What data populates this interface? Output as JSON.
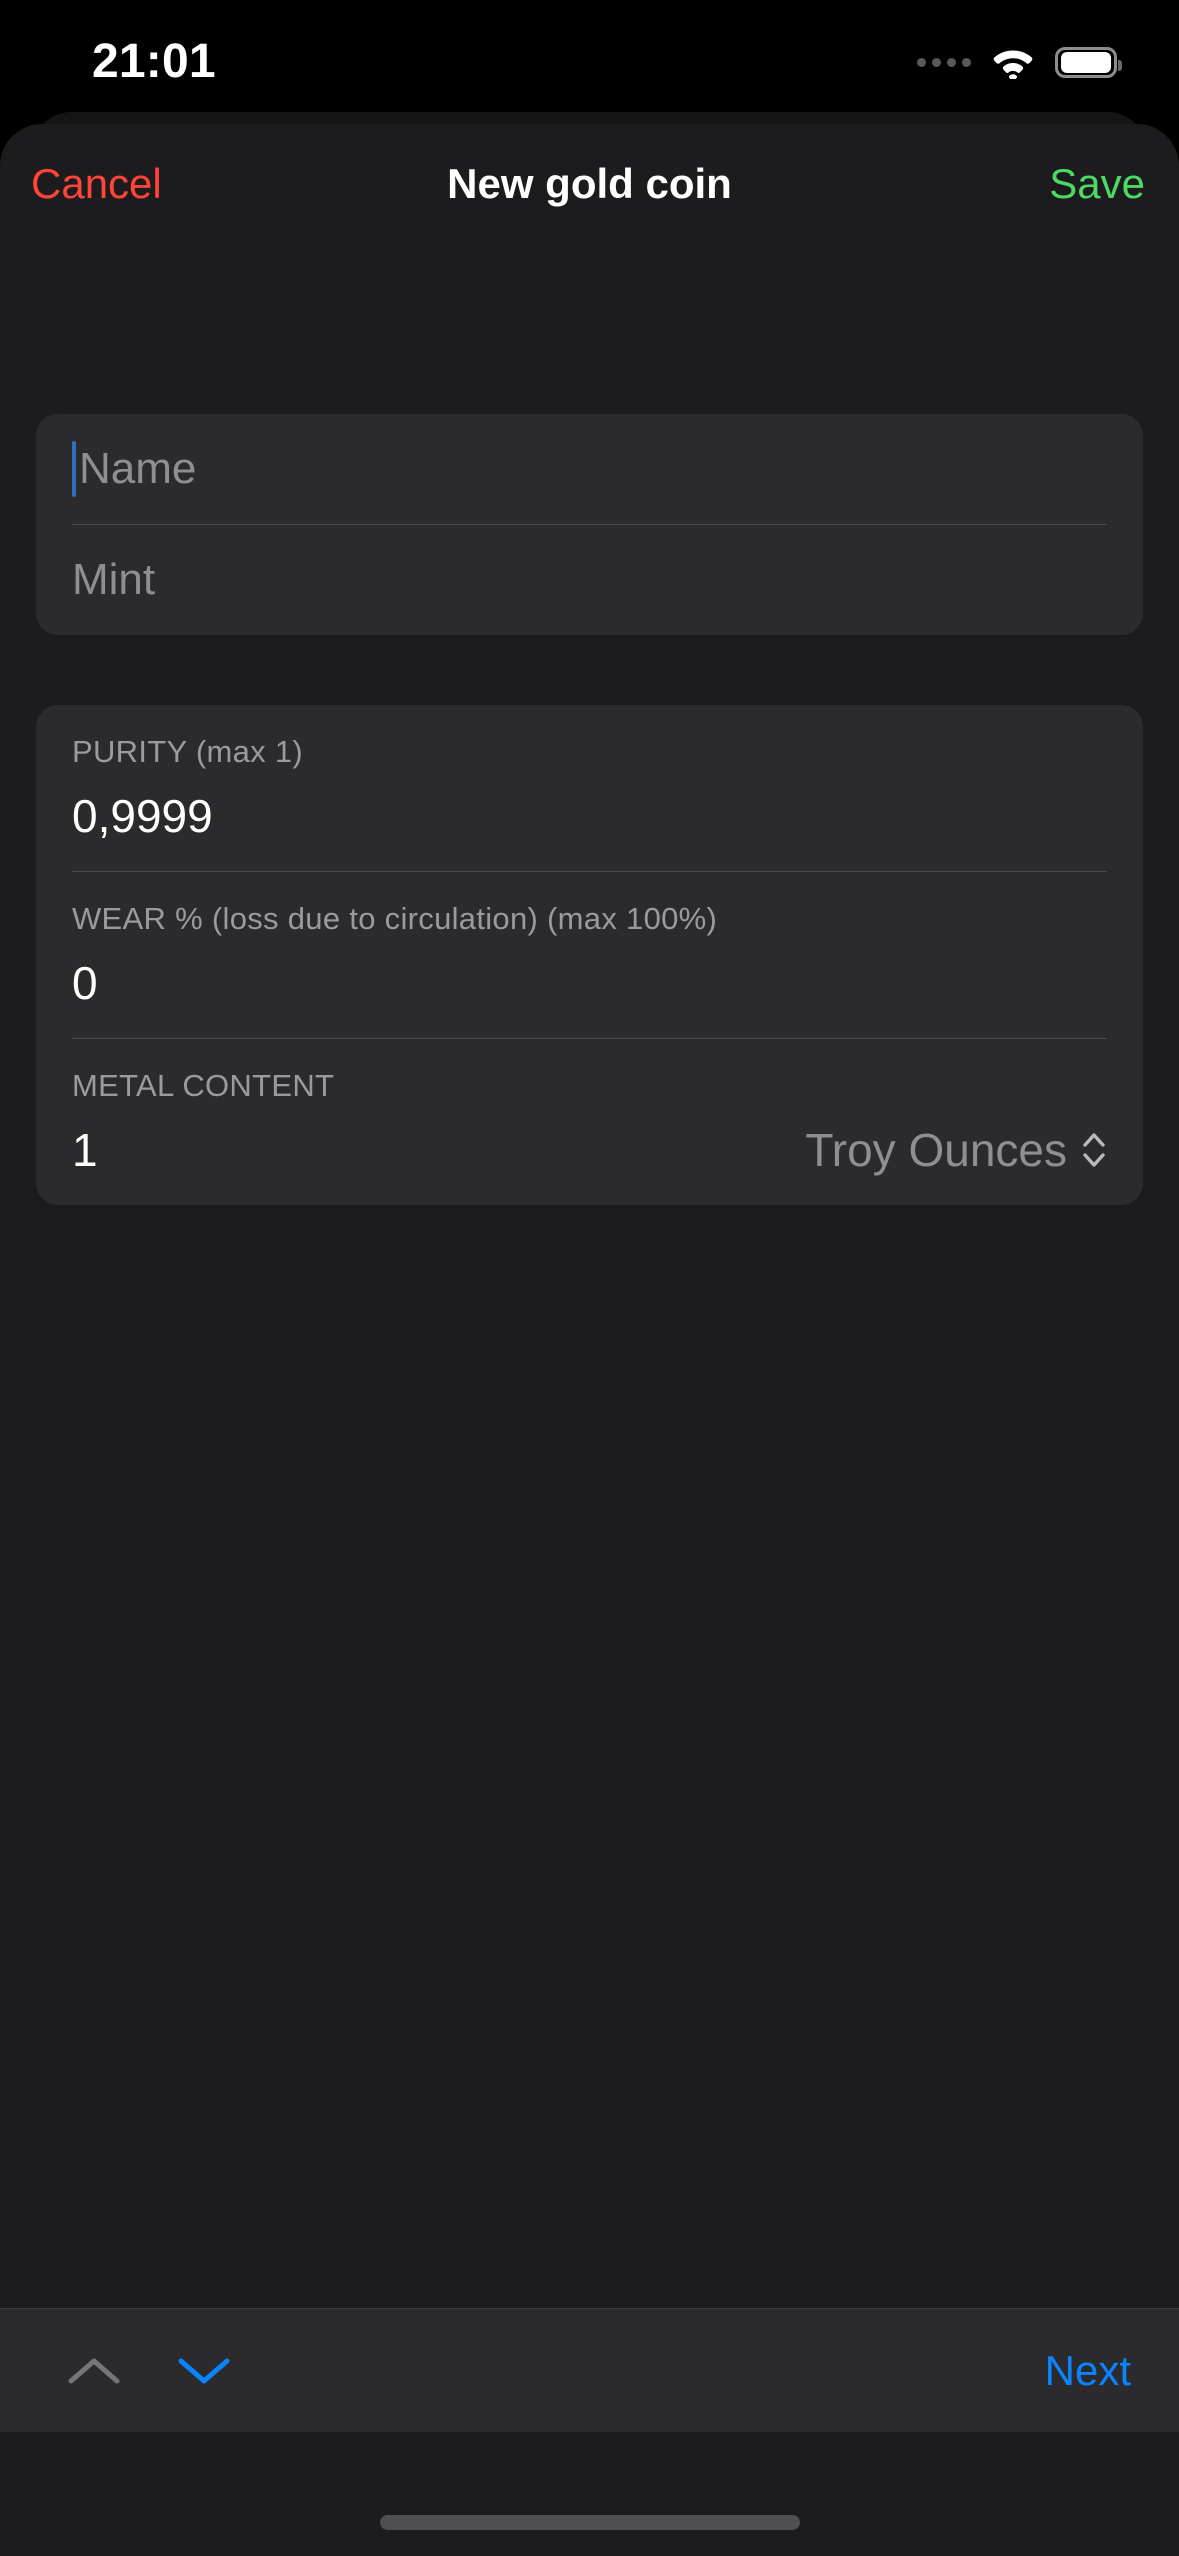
{
  "status_bar": {
    "time": "21:01",
    "cellular_icon": "cellular-dots-icon",
    "wifi_icon": "wifi-icon",
    "battery_icon": "battery-full-icon"
  },
  "navbar": {
    "cancel_label": "Cancel",
    "title": "New gold coin",
    "save_label": "Save",
    "cancel_color": "#ff453a",
    "save_color": "#4cd964"
  },
  "identity_card": {
    "name_field": {
      "value": "",
      "placeholder": "Name"
    },
    "mint_field": {
      "value": "",
      "placeholder": "Mint"
    }
  },
  "metrics_card": {
    "purity": {
      "label": "PURITY (max 1)",
      "value": "0,9999"
    },
    "wear": {
      "label": "WEAR % (loss due to circulation) (max 100%)",
      "value": "0"
    },
    "metal_content": {
      "label": "METAL CONTENT",
      "value": "1",
      "unit": "Troy Ounces",
      "unit_picker_icon": "chevron-up-down-icon"
    }
  },
  "accessory_bar": {
    "prev_field_icon": "chevron-up-icon",
    "next_field_icon": "chevron-down-icon",
    "prev_field_enabled": "false",
    "next_field_enabled": "true",
    "next_label": "Next",
    "accent_color": "#0a84ff",
    "disabled_color": "#767679"
  },
  "system": {
    "home_indicator": "home-indicator"
  }
}
